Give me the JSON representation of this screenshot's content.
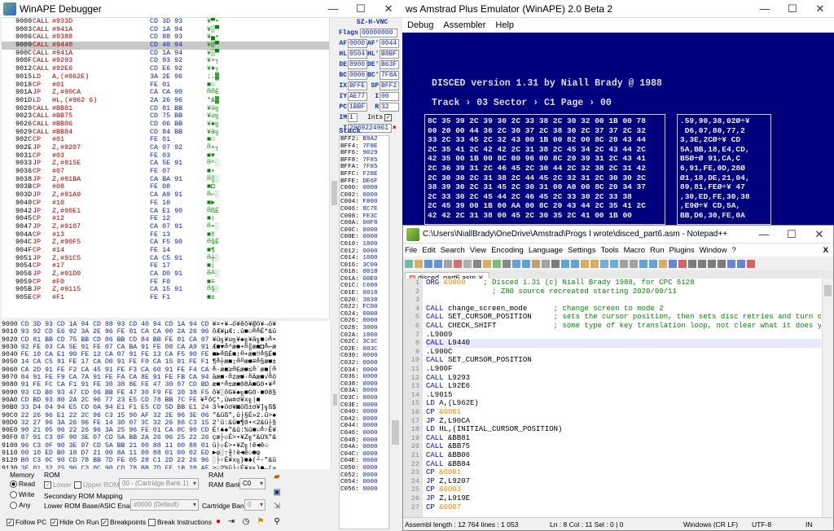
{
  "debugger": {
    "title": "WinAPE Debugger",
    "disasm": [
      {
        "a": "9000",
        "op": "CALL",
        "arg": "#933D",
        "b": "CD 3D 93",
        "g": "¥▀•"
      },
      {
        "a": "9003",
        "op": "CALL",
        "arg": "#941A",
        "b": "CD 1A 94",
        "g": "¥▒▀"
      },
      {
        "a": "9006",
        "op": "CALL",
        "arg": "#9388",
        "b": "CD 88 93",
        "g": "¥▄•"
      },
      {
        "a": "9009",
        "op": "CALL",
        "arg": "#9440",
        "b": "CD 40 94",
        "g": "¥@▀",
        "sel": true
      },
      {
        "a": "900C",
        "op": "CALL",
        "arg": "#941A",
        "b": "CD 1A 94",
        "g": "¥▒▀"
      },
      {
        "a": "900F",
        "op": "CALL",
        "arg": "#9293",
        "b": "CD 93 92",
        "g": "¥•┐"
      },
      {
        "a": "9012",
        "op": "CALL",
        "arg": "#92E6",
        "b": "CD E6 92",
        "g": "¥♦┐"
      },
      {
        "a": "9015",
        "op": "LD",
        "arg": "A,(#962E)",
        "b": "3A 2E 96",
        "g": ":.▓"
      },
      {
        "a": "9018",
        "op": "CP",
        "arg": "#01",
        "b": "FE 01",
        "g": "■☺"
      },
      {
        "a": "901A",
        "op": "JP",
        "arg": "Z,#90CA",
        "b": "CA CA 90",
        "g": "╩╩É"
      },
      {
        "a": "901D",
        "op": "LD",
        "arg": "HL,(#962 6)",
        "b": "2A 26 96",
        "g": "*&▓"
      },
      {
        "a": "9020",
        "op": "CALL",
        "arg": "#BB81",
        "b": "CD 81 BB",
        "g": "¥ü╗"
      },
      {
        "a": "9023",
        "op": "CALL",
        "arg": "#BB75",
        "b": "CD 75 BB",
        "g": "¥u╗"
      },
      {
        "a": "9026",
        "op": "CALL",
        "arg": "#BB06",
        "b": "CD 06 BB",
        "g": "¥♠╗"
      },
      {
        "a": "9029",
        "op": "CALL",
        "arg": "#BB84",
        "b": "CD 84 BB",
        "g": "¥ä╗"
      },
      {
        "a": "902C",
        "op": "CP",
        "arg": "#01",
        "b": "FE 01",
        "g": "■☺"
      },
      {
        "a": "902E",
        "op": "JP",
        "arg": "Z,#9207",
        "b": "CA 07 92",
        "g": "╩•┐"
      },
      {
        "a": "9031",
        "op": "CP",
        "arg": "#03",
        "b": "FE 03",
        "g": "■♥"
      },
      {
        "a": "9033",
        "op": "JP",
        "arg": "Z,#915E",
        "b": "CA 5E 91",
        "g": "╩^░"
      },
      {
        "a": "9036",
        "op": "CP",
        "arg": "#07",
        "b": "FE 07",
        "g": "■•"
      },
      {
        "a": "9038",
        "op": "JP",
        "arg": "Z,#91BA",
        "b": "CA BA 91",
        "g": "╩║░"
      },
      {
        "a": "903B",
        "op": "CP",
        "arg": "#08",
        "b": "FE 08",
        "g": "■◘"
      },
      {
        "a": "903D",
        "op": "JP",
        "arg": "Z,#91A9",
        "b": "CA A9 91",
        "g": "╩⌐░"
      },
      {
        "a": "9040",
        "op": "CP",
        "arg": "#10",
        "b": "FE 10",
        "g": "■►"
      },
      {
        "a": "9042",
        "op": "JP",
        "arg": "Z,#90E1",
        "b": "CA E1 90",
        "g": "╩ßÉ"
      },
      {
        "a": "9045",
        "op": "CP",
        "arg": "#12",
        "b": "FE 12",
        "g": "■↕"
      },
      {
        "a": "9047",
        "op": "JP",
        "arg": "Z,#9107",
        "b": "CA 07 91",
        "g": "╩•░"
      },
      {
        "a": "904A",
        "op": "CP",
        "arg": "#13",
        "b": "FE 13",
        "g": "■‼"
      },
      {
        "a": "904C",
        "op": "JP",
        "arg": "Z,#90F5",
        "b": "CA F5 90",
        "g": "╩§É"
      },
      {
        "a": "904F",
        "op": "CP",
        "arg": "#14",
        "b": "FE 14",
        "g": "■¶"
      },
      {
        "a": "9051",
        "op": "JP",
        "arg": "Z,#91C5",
        "b": "CA C5 91",
        "g": "╩┼░"
      },
      {
        "a": "9054",
        "op": "CP",
        "arg": "#17",
        "b": "FE 17",
        "g": "■↨"
      },
      {
        "a": "9056",
        "op": "JP",
        "arg": "Z,#91D0",
        "b": "CA D0 91",
        "g": "╩╨░"
      },
      {
        "a": "9059",
        "op": "CP",
        "arg": "#F0",
        "b": "FE F0",
        "g": "■≡"
      },
      {
        "a": "905B",
        "op": "JP",
        "arg": "Z,#9115",
        "b": "CA 15 91",
        "g": "╩§░"
      },
      {
        "a": "905E",
        "op": "CP",
        "arg": "#F1",
        "b": "FE F1",
        "g": "■±"
      }
    ],
    "flags_label": "SZ-H-VNC",
    "flags_name": "Flags",
    "flags_value": "00000000",
    "regs": [
      {
        "n": "AF",
        "v": "0000",
        "n2": "AF'",
        "v2": "0044"
      },
      {
        "n": "HL",
        "v": "0504",
        "n2": "HL'",
        "v2": "B8BF"
      },
      {
        "n": "DE",
        "v": "8900",
        "n2": "DE'",
        "v2": "B63F"
      },
      {
        "n": "BC",
        "v": "0000",
        "n2": "BC'",
        "v2": "7F8A"
      },
      {
        "n": "IX",
        "v": "BFFE",
        "n2": "SP",
        "v2": "BFF2"
      },
      {
        "n": "IY",
        "v": "AE77",
        "n2": "I",
        "v2": "00"
      },
      {
        "n": "PC",
        "v": "1BBF",
        "n2": "R",
        "v2": "32"
      }
    ],
    "im_label": "IM",
    "im_value": "1",
    "ints_label": "Ints",
    "t_label": "T",
    "t_value": "2989224961",
    "stack_label": "Stack",
    "stack": [
      {
        "a": "BFF2:",
        "v": "B9A2"
      },
      {
        "a": "BFF4:",
        "v": "7F8E"
      },
      {
        "a": "BFF6:",
        "v": "9029"
      },
      {
        "a": "BFF8:",
        "v": "7F85"
      },
      {
        "a": "BFFA:",
        "v": "7F85"
      },
      {
        "a": "BFFC:",
        "v": "F28E"
      },
      {
        "a": "BFFE:",
        "v": "DE6F"
      },
      {
        "a": "C000:",
        "v": "0000"
      },
      {
        "a": "C002:",
        "v": "0000"
      },
      {
        "a": "C004:",
        "v": "F800"
      },
      {
        "a": "C006:",
        "v": "8C7E"
      },
      {
        "a": "C008:",
        "v": "FE3C"
      },
      {
        "a": "C00A:",
        "v": "00F8"
      },
      {
        "a": "C00C:",
        "v": "0000"
      },
      {
        "a": "C00E:",
        "v": "0000"
      },
      {
        "a": "C010:",
        "v": "1800"
      },
      {
        "a": "C012:",
        "v": "0000"
      },
      {
        "a": "C014:",
        "v": "1800"
      },
      {
        "a": "C016:",
        "v": "3C00"
      },
      {
        "a": "C018:",
        "v": "0018"
      },
      {
        "a": "C01A:",
        "v": "00E0"
      },
      {
        "a": "C01C:",
        "v": "C600"
      },
      {
        "a": "C01E:",
        "v": "0018"
      },
      {
        "a": "C020:",
        "v": "3838"
      },
      {
        "a": "C022:",
        "v": "FC00"
      },
      {
        "a": "C024:",
        "v": "0000"
      },
      {
        "a": "C026:",
        "v": "0000"
      },
      {
        "a": "C028:",
        "v": "3800"
      },
      {
        "a": "C02A:",
        "v": "1800"
      },
      {
        "a": "C02C:",
        "v": "3C3C"
      },
      {
        "a": "C02E:",
        "v": "003C"
      },
      {
        "a": "C030:",
        "v": "0000"
      },
      {
        "a": "C032:",
        "v": "0000"
      },
      {
        "a": "C034:",
        "v": "0000"
      },
      {
        "a": "C036:",
        "v": "0000"
      },
      {
        "a": "C038:",
        "v": "0000"
      },
      {
        "a": "C03A:",
        "v": "0000"
      },
      {
        "a": "C03C:",
        "v": "0000"
      },
      {
        "a": "C03E:",
        "v": "0000"
      },
      {
        "a": "C040:",
        "v": "0000"
      },
      {
        "a": "C042:",
        "v": "0000"
      },
      {
        "a": "C044:",
        "v": "0000"
      },
      {
        "a": "C046:",
        "v": "0000"
      },
      {
        "a": "C048:",
        "v": "0000"
      },
      {
        "a": "C04A:",
        "v": "0000"
      },
      {
        "a": "C04C:",
        "v": "0000"
      },
      {
        "a": "C04E:",
        "v": "0000"
      },
      {
        "a": "C050:",
        "v": "0000"
      },
      {
        "a": "C052:",
        "v": "0000"
      },
      {
        "a": "C054:",
        "v": "0000"
      },
      {
        "a": "C056:",
        "v": "0000"
      }
    ],
    "memory": [
      {
        "a": "9000",
        "b": "CD 3D 93 CD 1A 94 CD 88 93 CD 40 94 CD 1A 94 CD",
        "c": "¥=•¥→ö¥êô¥@ö¥→ö¥"
      },
      {
        "a": "9010",
        "b": "93 92 CD E6 92 3A 2E 96 FE 01 CA CA 90 2A 26 96",
        "c": "ôÆ¥µÆ:.û■☺╩╩É*&û"
      },
      {
        "a": "9020",
        "b": "CD 81 BB CD 75 BB CD 06 BB CD 84 BB FE 01 CA 07",
        "c": "¥ü╗¥u╗¥♠╗¥ä╗■☺╩•"
      },
      {
        "a": "9030",
        "b": "92 FE 03 CA 5E 91 FE 07 CA BA 91 FE 08 CA A9 91",
        "c": "Æ■♥╩^æ■•╩║æ■◘╩⌐æ"
      },
      {
        "a": "9040",
        "b": "FE 10 CA E1 90 FE 12 CA 07 91 FE 13 CA F5 90 FE",
        "c": "■►╩ßÉ■↕╩•æ■‼╩§É■"
      },
      {
        "a": "9050",
        "b": "14 CA C5 91 FE 17 CA D0 91 FE F0 CA 15 91 FE F1",
        "c": "¶╩┼æ■↨╩╨æ■≡╩§æ■±"
      },
      {
        "a": "9060",
        "b": "CA 2D 91 FE F2 CA 45 91 FE F3 CA 60 91 FE F4 CA",
        "c": "╩-æ■≥╩Eæ■≤╩`æ■⌠╩"
      },
      {
        "a": "9070",
        "b": "84 91 FE F9 CA 7A 91 FE FA CA 8E 91 FE FB CA 94",
        "c": "äæ■∙╩zæ■·╩Äæ■√╩ö"
      },
      {
        "a": "9080",
        "b": "91 FE FC CA F1 91 FE 30 38 8E FE 47 30 07 CD BD",
        "c": "æ■ⁿ╩±æ■08Ä■G0•¥╜"
      },
      {
        "a": "9090",
        "b": "93 CD B0 93 47 CD 06 BB FE 47 30 F9 FE 30 38 F5",
        "c": "ô¥░ôG¥♠╗■G0∙■08§"
      },
      {
        "a": "90A0",
        "b": "CD BD 93 80 2A 2C 96 77 23 E5 CD 78 BB 7C FE",
        "c": "¥╜ôÇ*,ûw#σ¥x╗|■"
      },
      {
        "a": "90B0",
        "b": "33 D4 04 94 E5 CD 0A 94 E1 F1 E5 CD 5D BB E1 24",
        "c": "3╘♦öσ¥◙öß±σ¥]╗ß$"
      },
      {
        "a": "90C0",
        "b": "22 26 96 E1 22 2C 96 C3 15 90 AF 32 2E 96 3E 06",
        "c": "\"&ûß\",û├§É»2.û>♠"
      },
      {
        "a": "90D0",
        "b": "32 27 96 3A 26 96 FE 14 30 07 3C 32 26 96 C3 15",
        "c": "2'û:&û■¶0•<2&û├§"
      },
      {
        "a": "90E0",
        "b": "90 21 05 06 22 26 96 3A 25 96 FE 01 CA 0C 90 CD",
        "c": "É!♣♠\"&û:%û■☺╩♀É¥"
      },
      {
        "a": "90F0",
        "b": "87 91 C3 0F 90 3E 07 CD 5A BB 2A 26 96 25 22 26",
        "c": "çæ├☼É>•¥Z╗*&û%\"&"
      },
      {
        "a": "9100",
        "b": "96 C3 0F 90 3E 07 CD 5A BB 21 00 88 11 00 88 01",
        "c": "û├☼É>•¥Z╗!ê◄ê☺"
      },
      {
        "a": "9110",
        "b": "00 10 ED B0 18 D7 21 00 8A 11 00 88 01 00 02 ED",
        "c": "►φ░↑╫!è◄ê☺☻φ"
      },
      {
        "a": "9120",
        "b": "B0 C3 0C 90 CD 78 BB 7D FE 05 28 C1 2D 22 26 96",
        "c": "░├♀É¥x╗}■♣(┴-\"&û"
      },
      {
        "a": "9130",
        "b": "3E 01 32 25 96 C3 0C 90 CD 78 BB 7D FE 1B 28 AF",
        "c": ">☺2%û├♀É¥x╗}■←(»"
      }
    ],
    "bottom": {
      "memory": "Memory",
      "read": "Read",
      "write": "Write",
      "any": "Any",
      "rom": "ROM",
      "lower": "Lower",
      "upper_rom": "Upper ROM:",
      "upper_rom_value": "00 - (Cartridge Bank 1)",
      "ram": "RAM",
      "ram_bank": "RAM Bank:",
      "ram_bank_value": "C0",
      "secondary": "Secondary ROM Mapping",
      "lower_rom_bank": "Lower ROM Base/ASIC Enable:",
      "lower_rom_value": "#0000 (Default)",
      "cartridge_bank": "Cartridge Bank:",
      "cartridge_value": "0",
      "follow_pc": "Follow PC",
      "hide_on_run": "Hide On Run",
      "breakpoints": "Breakpoints",
      "break_instructions": "Break Instructions"
    }
  },
  "emulator": {
    "title": "ws Amstrad Plus Emulator (WinAPE) 2.0 Beta 2",
    "menu": [
      "Debug",
      "Assembler",
      "Help"
    ],
    "line1": "DISCED  version 1.31 by Niall Brady @ 1988",
    "line2": "Track › 03    Sector › C1    Page › 00",
    "hex": "8C 35 39 2C 39 30 2C 33 38 2C 30 32 00 1B 00 78\n00 20 00 44 36 2C 30 37 2C 38 30 2C 37 37 2C 32\n33 2C 33 45 2C 32 43 00 1B 00 82 00 8C 20 43 44\n2C 35 41 2C 42 42 2C 31 38 2C 45 34 2C 43 44 2C\n42 35 00 1B 00 8C 00 96 00 8C 20 39 31 2C 43 41\n2C 36 39 31 2C 46 45 2C 30 44 2C 32 38 2C 31 42\n2C 30 30 2C 31 38 2C 44 45 2C 32 31 2C 30 30 2C\n38 39 30 2C 31 45 2C 30 31 00 A0 00 8C 20 34 37\n2C 33 30 2C 45 44 2C 46 45 2C 33 30 2C 33 38\n2C 45 39 00 1B 00 AA 00 8C 20 43 44 2C 35 41 2C\n42 42 2C 31 38 00 45 2C 30 35 2C 41 00 1B 00",
    "ascii": ".59,90,38,02Ø÷¥\n D6,07,80,77,2\n3,3E,2CØ÷¥ CD\n5A,BB,18,E4,CD,\nB5Ø÷Ø 91,CA,C\n6,91,FE,0D,28Ø\nØ1,18,DE,21,04,\n89,81,FEØ÷¥ 47\n,30,ED,FE,30,38\n,E9Ø÷¥ CD,5A,\nBB,D6,30,FE,0A"
  },
  "notepad": {
    "title": "C:\\Users\\NiallBrady\\OneDrive\\Amstrad\\Progs I wrote\\disced_part6.asm - Notepad++",
    "menu": [
      "File",
      "Edit",
      "Search",
      "View",
      "Encoding",
      "Language",
      "Settings",
      "Tools",
      "Macro",
      "Run",
      "Plugins",
      "Window",
      "?"
    ],
    "close_x": "X",
    "tab": "disced_part6.asm",
    "lines": [
      [
        {
          "t": "ORG ",
          "c": "dir"
        },
        {
          "t": "&9000",
          "c": "num"
        },
        {
          "t": "    ; Disced 1.31 (c) Niall Brady 1988, for CPC 6128",
          "c": "cm"
        }
      ],
      [
        {
          "t": "               ; Z80 source recreated starting 2020/09/11",
          "c": "cm"
        }
      ],
      [
        {
          "t": "",
          "c": "pl"
        }
      ],
      [
        {
          "t": "CALL ",
          "c": "kw"
        },
        {
          "t": "change_screen_mode      ",
          "c": "pl"
        },
        {
          "t": "; change screen to mode 2",
          "c": "cm"
        }
      ],
      [
        {
          "t": "CALL ",
          "c": "kw"
        },
        {
          "t": "SET_CURSOR_POSITION     ",
          "c": "pl"
        },
        {
          "t": "; sets the cursor position, then sets disc retries and turn o",
          "c": "cm"
        }
      ],
      [
        {
          "t": "CALL ",
          "c": "kw"
        },
        {
          "t": "CHECK_SHIFT             ",
          "c": "pl"
        },
        {
          "t": "; some type of key translation loop, not clear what it does y",
          "c": "cm"
        }
      ],
      [
        {
          "t": ".L9009",
          "c": "pl"
        }
      ],
      [
        {
          "t": "CALL ",
          "c": "kw"
        },
        {
          "t": "L9440",
          "c": "pl"
        }
      ],
      [
        {
          "t": ".L900C",
          "c": "pl"
        }
      ],
      [
        {
          "t": "CALL ",
          "c": "kw"
        },
        {
          "t": "SET_CURSOR_POSITION",
          "c": "pl"
        }
      ],
      [
        {
          "t": ".L900F",
          "c": "pl"
        }
      ],
      [
        {
          "t": "CALL ",
          "c": "kw"
        },
        {
          "t": "L9293",
          "c": "pl"
        }
      ],
      [
        {
          "t": "CALL ",
          "c": "kw"
        },
        {
          "t": "L92E6",
          "c": "pl"
        }
      ],
      [
        {
          "t": ".L9015",
          "c": "pl"
        }
      ],
      [
        {
          "t": "LD ",
          "c": "kw"
        },
        {
          "t": "A,(L962E)",
          "c": "pl"
        }
      ],
      [
        {
          "t": "CP ",
          "c": "kw"
        },
        {
          "t": "&0001",
          "c": "num"
        }
      ],
      [
        {
          "t": "JP ",
          "c": "kw"
        },
        {
          "t": "Z,L90CA",
          "c": "pl"
        }
      ],
      [
        {
          "t": "LD ",
          "c": "kw"
        },
        {
          "t": "HL,(INITIAL_CURSOR_POSITION)",
          "c": "pl"
        }
      ],
      [
        {
          "t": "CALL ",
          "c": "kw"
        },
        {
          "t": "&BB81",
          "c": "pl"
        }
      ],
      [
        {
          "t": "CALL ",
          "c": "kw"
        },
        {
          "t": "&BB75",
          "c": "pl"
        }
      ],
      [
        {
          "t": "CALL ",
          "c": "kw"
        },
        {
          "t": "&BB06",
          "c": "pl"
        }
      ],
      [
        {
          "t": "CALL ",
          "c": "kw"
        },
        {
          "t": "&BB84",
          "c": "pl"
        }
      ],
      [
        {
          "t": "CP ",
          "c": "kw"
        },
        {
          "t": "&0001",
          "c": "num"
        }
      ],
      [
        {
          "t": "JP ",
          "c": "kw"
        },
        {
          "t": "Z,L9207",
          "c": "pl"
        }
      ],
      [
        {
          "t": "CP ",
          "c": "kw"
        },
        {
          "t": "&0003",
          "c": "num"
        }
      ],
      [
        {
          "t": "JP ",
          "c": "kw"
        },
        {
          "t": "Z,L919E",
          "c": "pl"
        }
      ],
      [
        {
          "t": "CP ",
          "c": "kw"
        },
        {
          "t": "&0007",
          "c": "num"
        }
      ]
    ],
    "current_line": 8,
    "status": {
      "info": "Assembl length : 12 764    lines : 1 053",
      "pos": "Ln : 8    Col : 11    Sel : 0 | 0",
      "eol": "Windows (CR LF)",
      "enc": "UTF-8",
      "ins": "IN"
    }
  }
}
